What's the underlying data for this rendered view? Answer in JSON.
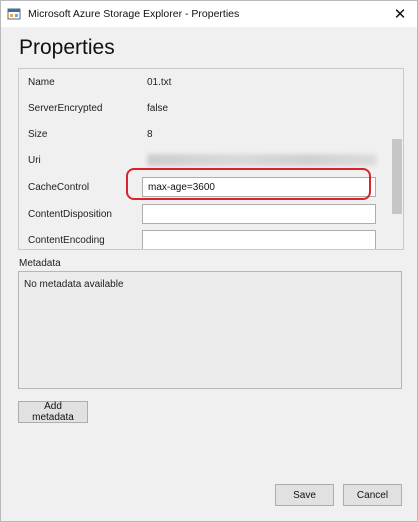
{
  "window": {
    "title": "Microsoft Azure Storage Explorer - Properties",
    "close_symbol": "✕",
    "app_icon": "storage-explorer-icon"
  },
  "page_title": "Properties",
  "properties": [
    {
      "name": "Name",
      "value": "01.txt",
      "kind": "text"
    },
    {
      "name": "ServerEncrypted",
      "value": "false",
      "kind": "text"
    },
    {
      "name": "Size",
      "value": "8",
      "kind": "text"
    },
    {
      "name": "Uri",
      "value": "",
      "kind": "blurred"
    },
    {
      "name": "CacheControl",
      "value": "max-age=3600",
      "kind": "input"
    },
    {
      "name": "ContentDisposition",
      "value": "",
      "kind": "input"
    },
    {
      "name": "ContentEncoding",
      "value": "",
      "kind": "input"
    }
  ],
  "highlight_color": "#d9242b",
  "metadata": {
    "label": "Metadata",
    "empty_text": "No metadata available",
    "add_button": "Add metadata"
  },
  "footer": {
    "save": "Save",
    "cancel": "Cancel"
  }
}
